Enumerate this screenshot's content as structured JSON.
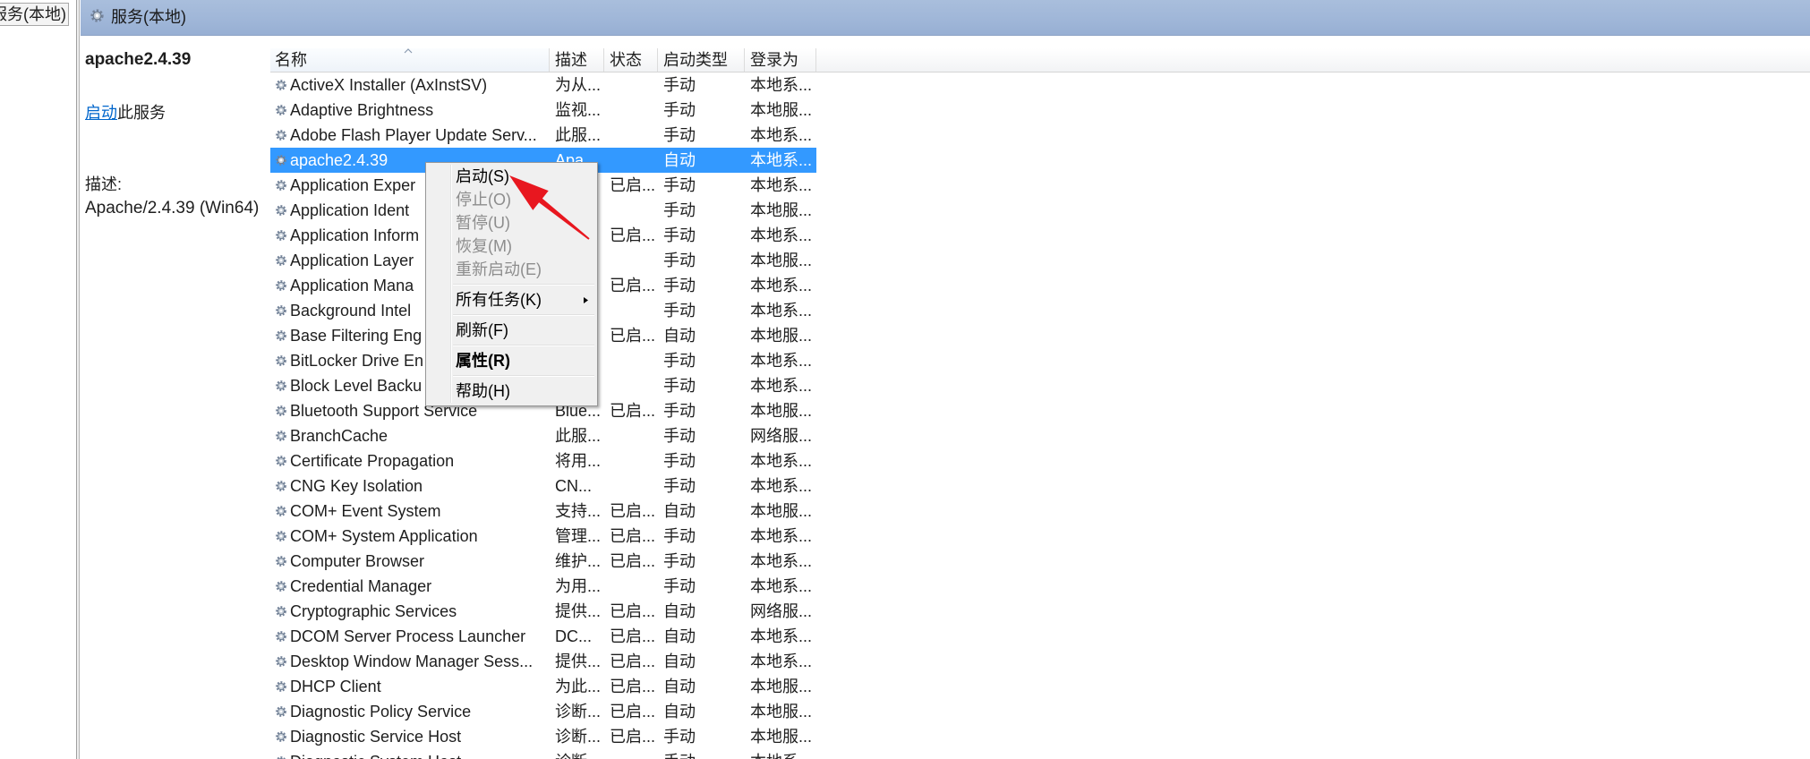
{
  "tree": {
    "root_label": "服务(本地)"
  },
  "header": {
    "title": "服务(本地)",
    "icon": "services-icon"
  },
  "detail": {
    "service_name": "apache2.4.39",
    "action_link": "启动",
    "action_suffix": "此服务",
    "description_label": "描述:",
    "description": "Apache/2.4.39 (Win64)"
  },
  "list": {
    "columns": [
      "名称",
      "描述",
      "状态",
      "启动类型",
      "登录为"
    ],
    "sort_column": "名称",
    "sort_direction": "ascending",
    "selected_index": 3,
    "row_icon": "service-gear-icon",
    "rows": [
      {
        "name": "ActiveX Installer (AxInstSV)",
        "desc": "为从...",
        "status": "",
        "startup": "手动",
        "logon": "本地系..."
      },
      {
        "name": "Adaptive Brightness",
        "desc": "监视...",
        "status": "",
        "startup": "手动",
        "logon": "本地服..."
      },
      {
        "name": "Adobe Flash Player Update Serv...",
        "desc": "此服...",
        "status": "",
        "startup": "手动",
        "logon": "本地系..."
      },
      {
        "name": "apache2.4.39",
        "desc": "Apa...",
        "status": "",
        "startup": "自动",
        "logon": "本地系..."
      },
      {
        "name": "Application Exper",
        "desc": "",
        "status": "已启...",
        "startup": "手动",
        "logon": "本地系..."
      },
      {
        "name": "Application Ident",
        "desc": "",
        "status": "",
        "startup": "手动",
        "logon": "本地服..."
      },
      {
        "name": "Application Inform",
        "desc": "",
        "status": "已启...",
        "startup": "手动",
        "logon": "本地系..."
      },
      {
        "name": "Application Layer",
        "desc": "",
        "status": "",
        "startup": "手动",
        "logon": "本地服..."
      },
      {
        "name": "Application Mana",
        "desc": "",
        "status": "已启...",
        "startup": "手动",
        "logon": "本地系..."
      },
      {
        "name": "Background Intel",
        "desc": "",
        "status": "",
        "startup": "手动",
        "logon": "本地系..."
      },
      {
        "name": "Base Filtering Eng",
        "desc": "",
        "status": "已启...",
        "startup": "自动",
        "logon": "本地服..."
      },
      {
        "name": "BitLocker Drive En",
        "desc": "",
        "status": "",
        "startup": "手动",
        "logon": "本地系..."
      },
      {
        "name": "Block Level Backu",
        "desc": "",
        "status": "",
        "startup": "手动",
        "logon": "本地系..."
      },
      {
        "name": "Bluetooth Support Service",
        "desc": "Blue...",
        "status": "已启...",
        "startup": "手动",
        "logon": "本地服..."
      },
      {
        "name": "BranchCache",
        "desc": "此服...",
        "status": "",
        "startup": "手动",
        "logon": "网络服..."
      },
      {
        "name": "Certificate Propagation",
        "desc": "将用...",
        "status": "",
        "startup": "手动",
        "logon": "本地系..."
      },
      {
        "name": "CNG Key Isolation",
        "desc": "CN...",
        "status": "",
        "startup": "手动",
        "logon": "本地系..."
      },
      {
        "name": "COM+ Event System",
        "desc": "支持...",
        "status": "已启...",
        "startup": "自动",
        "logon": "本地服..."
      },
      {
        "name": "COM+ System Application",
        "desc": "管理...",
        "status": "已启...",
        "startup": "手动",
        "logon": "本地系..."
      },
      {
        "name": "Computer Browser",
        "desc": "维护...",
        "status": "已启...",
        "startup": "手动",
        "logon": "本地系..."
      },
      {
        "name": "Credential Manager",
        "desc": "为用...",
        "status": "",
        "startup": "手动",
        "logon": "本地系..."
      },
      {
        "name": "Cryptographic Services",
        "desc": "提供...",
        "status": "已启...",
        "startup": "自动",
        "logon": "网络服..."
      },
      {
        "name": "DCOM Server Process Launcher",
        "desc": "DC...",
        "status": "已启...",
        "startup": "自动",
        "logon": "本地系..."
      },
      {
        "name": "Desktop Window Manager Sess...",
        "desc": "提供...",
        "status": "已启...",
        "startup": "自动",
        "logon": "本地系..."
      },
      {
        "name": "DHCP Client",
        "desc": "为此...",
        "status": "已启...",
        "startup": "自动",
        "logon": "本地服..."
      },
      {
        "name": "Diagnostic Policy Service",
        "desc": "诊断...",
        "status": "已启...",
        "startup": "自动",
        "logon": "本地服..."
      },
      {
        "name": "Diagnostic Service Host",
        "desc": "诊断...",
        "status": "已启...",
        "startup": "手动",
        "logon": "本地服..."
      },
      {
        "name": "Diagnostic System Host",
        "desc": "诊断...",
        "status": "",
        "startup": "手动",
        "logon": "本地系..."
      }
    ]
  },
  "context_menu": {
    "groups": [
      [
        {
          "label": "启动(S)",
          "enabled": true
        },
        {
          "label": "停止(O)",
          "enabled": false
        },
        {
          "label": "暂停(U)",
          "enabled": false
        },
        {
          "label": "恢复(M)",
          "enabled": false
        },
        {
          "label": "重新启动(E)",
          "enabled": false
        }
      ],
      [
        {
          "label": "所有任务(K)",
          "enabled": true,
          "submenu": true
        }
      ],
      [
        {
          "label": "刷新(F)",
          "enabled": true
        }
      ],
      [
        {
          "label": "属性(R)",
          "enabled": true,
          "default": true
        }
      ],
      [
        {
          "label": "帮助(H)",
          "enabled": true
        }
      ]
    ]
  },
  "colors": {
    "selection": "#3399ff",
    "link": "#0066cc",
    "annotation_arrow": "#e8171f",
    "header_bar": "#9fb6d8"
  }
}
